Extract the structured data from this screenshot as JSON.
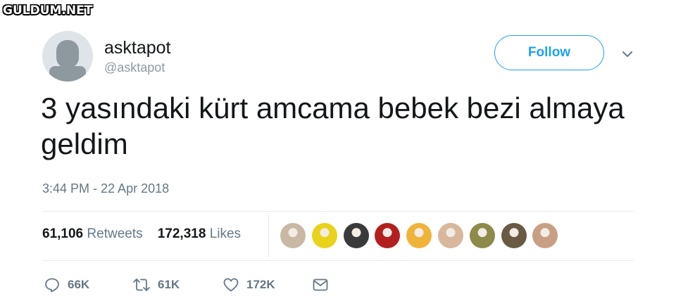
{
  "watermark": "GULDUM.NET",
  "tweet": {
    "author_name": "asktapot",
    "author_handle": "@asktapot",
    "text": "3 yasındaki kürt amcama bebek bezi almaya geldim",
    "timestamp": "3:44 PM - 22 Apr 2018"
  },
  "header": {
    "follow_label": "Follow"
  },
  "stats": {
    "retweets_count": "61,106",
    "retweets_label": "Retweets",
    "likes_count": "172,318",
    "likes_label": "Likes",
    "likers": [
      {
        "name": "liker-1",
        "color": "#c9b8a4"
      },
      {
        "name": "liker-2",
        "color": "#e8d31a"
      },
      {
        "name": "liker-3",
        "color": "#3a3a3a"
      },
      {
        "name": "liker-4",
        "color": "#b31f1f"
      },
      {
        "name": "liker-5",
        "color": "#f0b33a"
      },
      {
        "name": "liker-6",
        "color": "#d8b89c"
      },
      {
        "name": "liker-7",
        "color": "#8d8a4a"
      },
      {
        "name": "liker-8",
        "color": "#6a5a44"
      },
      {
        "name": "liker-9",
        "color": "#c89f84"
      }
    ]
  },
  "actions": {
    "replies": "66K",
    "retweets": "61K",
    "likes": "172K"
  },
  "colors": {
    "accent": "#1da1f2",
    "secondary_text": "#657786",
    "border": "#e6ecf0"
  }
}
